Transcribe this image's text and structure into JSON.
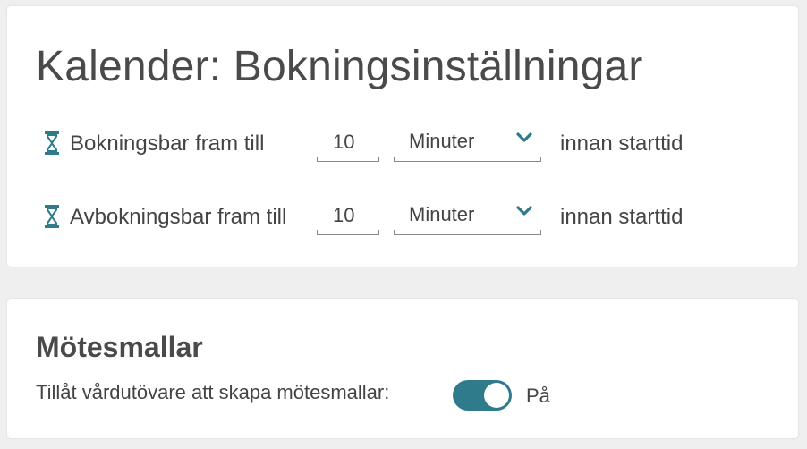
{
  "booking": {
    "title": "Kalender: Bokningsinställningar",
    "rows": [
      {
        "label": "Bokningsbar fram till",
        "value": "10",
        "unit": "Minuter",
        "suffix": "innan starttid",
        "icon": "hourglass-icon"
      },
      {
        "label": "Avbokningsbar fram till",
        "value": "10",
        "unit": "Minuter",
        "suffix": "innan starttid",
        "icon": "hourglass-icon"
      }
    ]
  },
  "templates": {
    "title": "Mötesmallar",
    "toggle_label": "Tillåt vårdutövare att skapa mötesmallar:",
    "toggle_on": true,
    "toggle_state": "På"
  },
  "colors": {
    "accent": "#2f7a8b",
    "background": "#efefef",
    "card": "#ffffff",
    "text": "#444444"
  }
}
